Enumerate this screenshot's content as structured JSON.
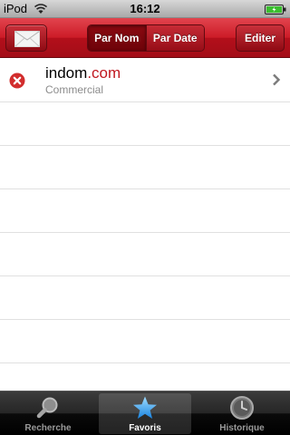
{
  "status_bar": {
    "carrier": "iPod",
    "time": "16:12",
    "battery_level": 1.0
  },
  "nav": {
    "segments": [
      "Par Nom",
      "Par Date"
    ],
    "selected_segment": "Par Nom",
    "edit_label": "Editer"
  },
  "favorites": [
    {
      "title_main": "indom",
      "title_tld": ".com",
      "subtitle": "Commercial"
    }
  ],
  "tabs": [
    {
      "label": "Recherche",
      "icon": "magnifier-icon"
    },
    {
      "label": "Favoris",
      "icon": "star-icon",
      "selected": true
    },
    {
      "label": "Historique",
      "icon": "clock-icon"
    }
  ],
  "colors": {
    "nav_red": "#cc1b27",
    "accent_red": "#c0171f",
    "delete_red": "#d22d2d"
  }
}
